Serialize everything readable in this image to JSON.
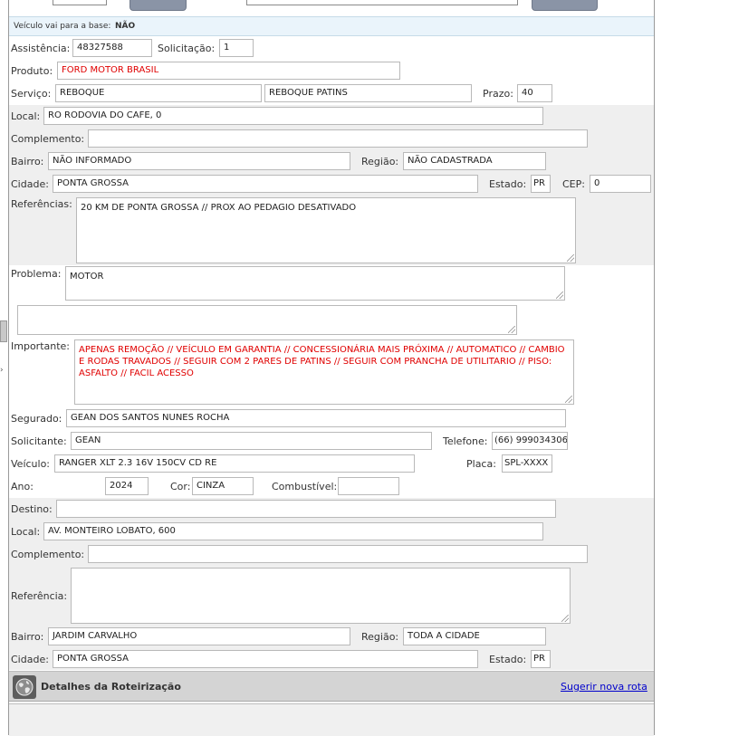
{
  "base_notice": {
    "label": "Veículo vai para a base:",
    "value": "NÃO"
  },
  "attendance": {
    "assistencia_label": "Assistência:",
    "assistencia": "48327588",
    "solicitacao_label": "Solicitação:",
    "solicitacao": "1",
    "produto_label": "Produto:",
    "produto": "FORD MOTOR BRASIL",
    "servico_label": "Serviço:",
    "servico": "REBOQUE",
    "servico2": "REBOQUE PATINS",
    "prazo_label": "Prazo:",
    "prazo": "40"
  },
  "origin": {
    "local_label": "Local:",
    "local": "RO RODOVIA DO CAFE, 0",
    "complemento_label": "Complemento:",
    "complemento": "",
    "bairro_label": "Bairro:",
    "bairro": "NÃO INFORMADO",
    "regiao_label": "Região:",
    "regiao": "NÃO CADASTRADA",
    "cidade_label": "Cidade:",
    "cidade": "PONTA GROSSA",
    "estado_label": "Estado:",
    "estado": "PR",
    "cep_label": "CEP:",
    "cep": "0",
    "referencias_label": "Referências:",
    "referencias": "20 KM DE PONTA GROSSA // PROX AO PEDAGIO DESATIVADO"
  },
  "problem": {
    "problema_label": "Problema:",
    "problema": "MOTOR",
    "extra": "",
    "importante_label": "Importante:",
    "importante": "APENAS REMOÇÃO // VEÍCULO EM GARANTIA // CONCESSIONÁRIA MAIS PRÓXIMA // AUTOMATICO // CAMBIO E RODAS TRAVADOS // SEGUIR COM 2 PARES DE PATINS // SEGUIR COM PRANCHA DE UTILITARIO // PISO: ASFALTO // FACIL ACESSO"
  },
  "client": {
    "segurado_label": "Segurado:",
    "segurado": "GEAN DOS SANTOS NUNES ROCHA",
    "solicitante_label": "Solicitante:",
    "solicitante": "GEAN",
    "telefone_label": "Telefone:",
    "telefone": "(66) 999034306",
    "veiculo_label": "Veículo:",
    "veiculo": "RANGER XLT 2.3 16V 150CV CD RE",
    "placa_label": "Placa:",
    "placa": "SPL-XXXX",
    "ano_label": "Ano:",
    "ano": "2024",
    "cor_label": "Cor:",
    "cor": "CINZA",
    "combustivel_label": "Combustível:",
    "combustivel": ""
  },
  "destination": {
    "destino_label": "Destino:",
    "destino": "",
    "local_label": "Local:",
    "local": "AV. MONTEIRO LOBATO, 600",
    "complemento_label": "Complemento:",
    "complemento": "",
    "referencia_label": "Referência:",
    "referencia": "",
    "bairro_label": "Bairro:",
    "bairro": "JARDIM CARVALHO",
    "regiao_label": "Região:",
    "regiao": "TODA A CIDADE",
    "cidade_label": "Cidade:",
    "cidade": "PONTA GROSSA",
    "estado_label": "Estado:",
    "estado": "PR"
  },
  "routing": {
    "title": "Detalhes da Roteirização",
    "suggest_link": "Sugerir nova rota",
    "icon": "globe-icon"
  },
  "colors": {
    "required_text": "#e00000",
    "link": "#0000cc",
    "panel_bg": "#efefef",
    "header_bg": "#d4d4d4"
  }
}
